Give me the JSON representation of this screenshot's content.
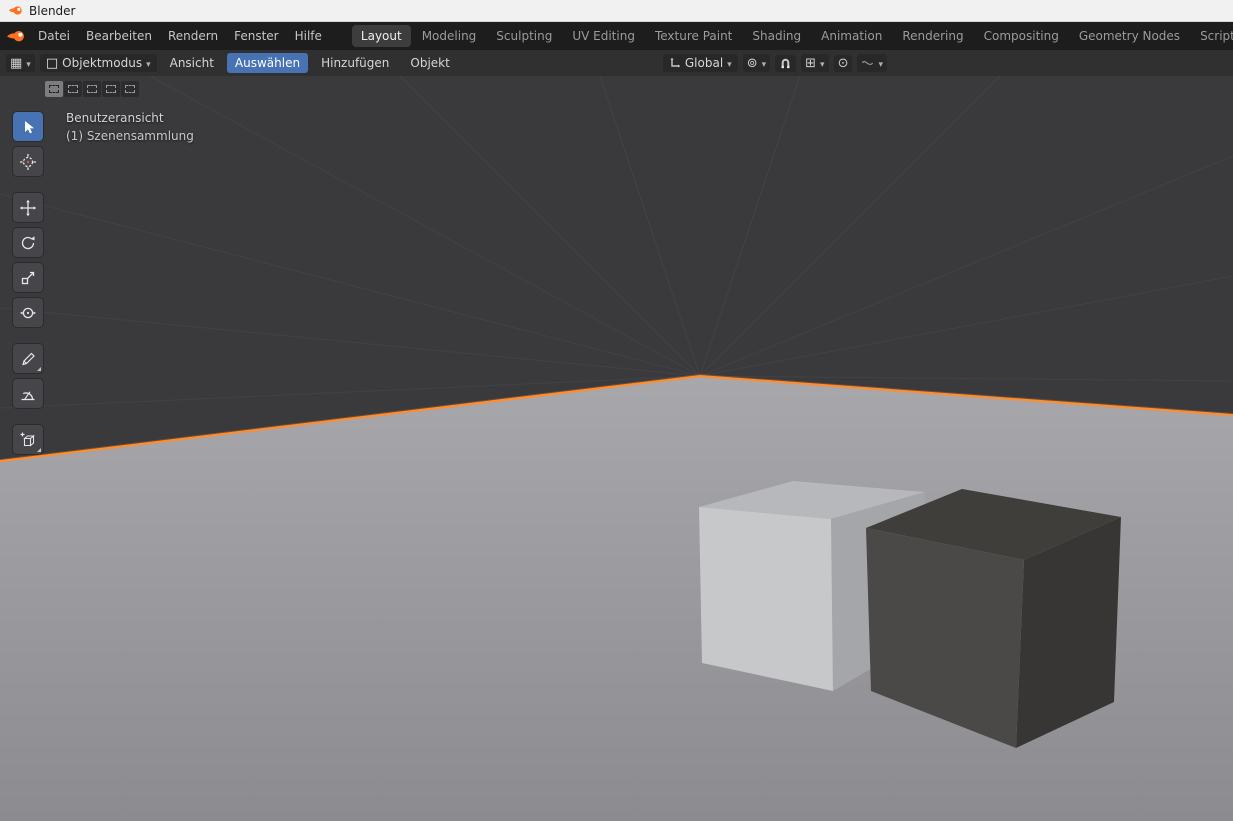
{
  "titlebar": {
    "app_title": "Blender"
  },
  "topbar": {
    "menus": [
      "Datei",
      "Bearbeiten",
      "Rendern",
      "Fenster",
      "Hilfe"
    ],
    "tabs": [
      "Layout",
      "Modeling",
      "Sculpting",
      "UV Editing",
      "Texture Paint",
      "Shading",
      "Animation",
      "Rendering",
      "Compositing",
      "Geometry Nodes",
      "Scripting"
    ],
    "active_tab": "Layout",
    "add_tab_label": "+"
  },
  "tool_header": {
    "mode_dropdown": {
      "label": "Objektmodus"
    },
    "menus": [
      "Ansicht",
      "Auswählen",
      "Hinzufügen",
      "Objekt"
    ],
    "active_menu": "Auswählen",
    "orientation_dropdown": {
      "label": "Global"
    },
    "icons": [
      "editor-type-icon",
      "object-mode-icon",
      "orientation-icon",
      "pivot-point-icon",
      "snap-magnet-icon",
      "snap-with-icon",
      "proportional-editing-icon",
      "falloff-curve-icon"
    ]
  },
  "tool_settings": {
    "select_mode_icons": [
      "select-set",
      "select-extend",
      "select-subtract",
      "select-invert",
      "select-intersect"
    ],
    "active": "select-set"
  },
  "toolshelf": {
    "tool_icons": [
      "tweak-select",
      "cursor-3d",
      "move",
      "rotate",
      "scale",
      "transform",
      "annotate",
      "measure",
      "add-cube"
    ],
    "active_tool": "tweak-select"
  },
  "viewport": {
    "view_label": "Benutzeransicht",
    "collection_label": "(1) Szenensammlung"
  },
  "colors": {
    "accent_blue": "#4772b3",
    "selection_outline": "#ff8d2e",
    "topbar_bg": "#1d1d1d",
    "header_bg": "#303030",
    "viewport_bg": "#3a3a3d",
    "floor_light": "#a8a8ac",
    "floor_dark": "#8b8b90",
    "light_cube": "#c7c8ca",
    "dark_cube": "#4b4947"
  }
}
